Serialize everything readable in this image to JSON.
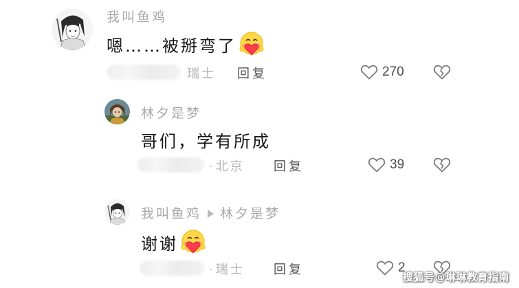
{
  "comments": [
    {
      "username": "我叫鱼鸡",
      "text": "嗯……被掰弯了",
      "emoji": "blush-heart-emoji",
      "location": "瑞士",
      "reply_label": "回复",
      "likes": "270"
    },
    {
      "username": "林夕是梦",
      "text": "哥们，学有所成",
      "location": "北京",
      "reply_label": "回复",
      "likes": "39"
    },
    {
      "username": "我叫鱼鸡",
      "reply_to": "林夕是梦",
      "text": "谢谢",
      "emoji": "blush-heart-emoji",
      "location": "瑞士",
      "reply_label": "回复",
      "likes": "2"
    }
  ],
  "watermark": "搜狐号@琳琳教育指南",
  "colors": {
    "username": "#a9a9a9",
    "meta": "#b3b3b3",
    "text": "#161616",
    "icon_stroke": "#7a7a7a"
  },
  "icons": {
    "like": "heart-outline-icon",
    "dislike": "broken-heart-icon",
    "reply_arrow": "triangle-arrow-icon"
  }
}
